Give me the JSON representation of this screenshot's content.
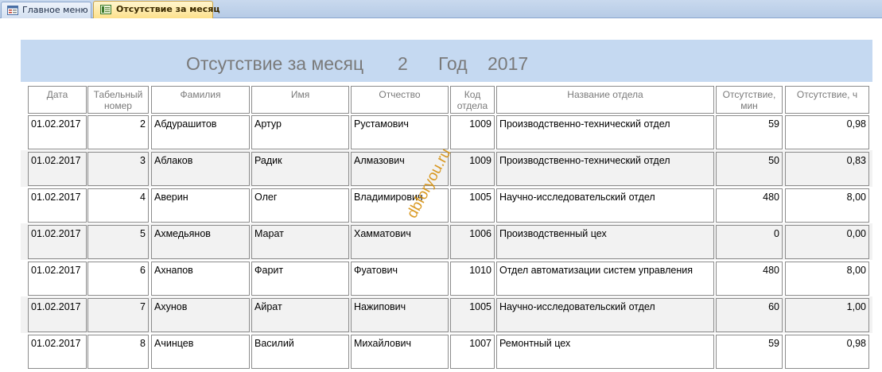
{
  "tabs": [
    {
      "label": "Главное меню",
      "icon": "form-icon",
      "active": false
    },
    {
      "label": "Отсутствие за месяц",
      "icon": "report-icon",
      "active": true
    }
  ],
  "report": {
    "title_prefix": "Отсутствие за месяц",
    "month": "2",
    "year_label": "Год",
    "year": "2017",
    "watermark": "dbforyou.ru"
  },
  "columns": [
    {
      "key": "date",
      "label": "Дата"
    },
    {
      "key": "tab_no",
      "label": "Табельный номер"
    },
    {
      "key": "last_name",
      "label": "Фамилия"
    },
    {
      "key": "first_name",
      "label": "Имя"
    },
    {
      "key": "patronymic",
      "label": "Отчество"
    },
    {
      "key": "dept_code",
      "label": "Код отдела"
    },
    {
      "key": "dept_name",
      "label": "Название отдела"
    },
    {
      "key": "absence_min",
      "label": "Отсутствие, мин"
    },
    {
      "key": "absence_h",
      "label": "Отсутствие, ч"
    }
  ],
  "rows": [
    [
      "01.02.2017",
      "2",
      "Абдурашитов",
      "Артур",
      "Рустамович",
      "1009",
      "Производственно-технический отдел",
      "59",
      "0,98"
    ],
    [
      "01.02.2017",
      "3",
      "Аблаков",
      "Радик",
      "Алмазович",
      "1009",
      "Производственно-технический отдел",
      "50",
      "0,83"
    ],
    [
      "01.02.2017",
      "4",
      "Аверин",
      "Олег",
      "Владимирович",
      "1005",
      "Научно-исследовательский отдел",
      "480",
      "8,00"
    ],
    [
      "01.02.2017",
      "5",
      "Ахмедьянов",
      "Марат",
      "Хамматович",
      "1006",
      "Производственный цех",
      "0",
      "0,00"
    ],
    [
      "01.02.2017",
      "6",
      "Ахнапов",
      "Фарит",
      "Фуатович",
      "1010",
      "Отдел автоматизации систем управления",
      "480",
      "8,00"
    ],
    [
      "01.02.2017",
      "7",
      "Ахунов",
      "Айрат",
      "Нажипович",
      "1005",
      "Научно-исследовательский отдел",
      "60",
      "1,00"
    ],
    [
      "01.02.2017",
      "8",
      "Ачинцев",
      "Василий",
      "Михайлович",
      "1007",
      "Ремонтный цех",
      "59",
      "0,98"
    ]
  ]
}
